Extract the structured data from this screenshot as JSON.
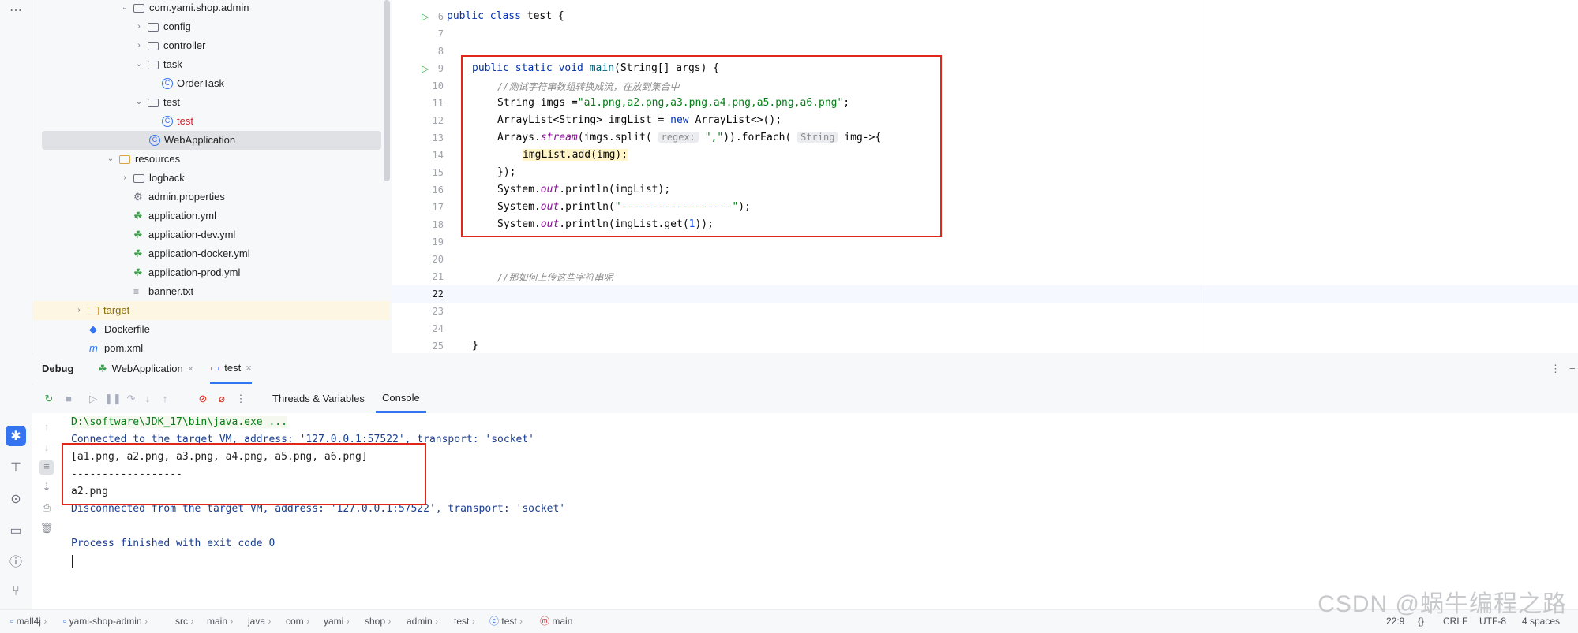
{
  "tree": {
    "items": [
      {
        "label": "com.yami.shop.admin",
        "type": "folder",
        "chev": "⌄"
      },
      {
        "label": "config",
        "type": "folder",
        "chev": "›"
      },
      {
        "label": "controller",
        "type": "folder",
        "chev": "›"
      },
      {
        "label": "task",
        "type": "folder",
        "chev": "⌄"
      },
      {
        "label": "OrderTask",
        "type": "class"
      },
      {
        "label": "test",
        "type": "folder",
        "chev": "⌄"
      },
      {
        "label": "test",
        "type": "class"
      },
      {
        "label": "WebApplication",
        "type": "class"
      },
      {
        "label": "resources",
        "type": "folder",
        "chev": "⌄"
      },
      {
        "label": "logback",
        "type": "folder",
        "chev": "›"
      },
      {
        "label": "admin.properties",
        "type": "props"
      },
      {
        "label": "application.yml",
        "type": "yml"
      },
      {
        "label": "application-dev.yml",
        "type": "yml"
      },
      {
        "label": "application-docker.yml",
        "type": "yml"
      },
      {
        "label": "application-prod.yml",
        "type": "yml"
      },
      {
        "label": "banner.txt",
        "type": "txt"
      },
      {
        "label": "target",
        "type": "folder",
        "chev": "›"
      },
      {
        "label": "Dockerfile",
        "type": "docker"
      },
      {
        "label": "pom.xml",
        "type": "maven"
      }
    ]
  },
  "editor": {
    "line_numbers": [
      "6",
      "7",
      "8",
      "9",
      "10",
      "11",
      "12",
      "13",
      "14",
      "15",
      "16",
      "17",
      "18",
      "19",
      "20",
      "21",
      "22",
      "23",
      "24",
      "25"
    ],
    "line1": {
      "kw": "public class ",
      "rest": "test {"
    },
    "line4": {
      "kw": "public static void ",
      "fn": "main",
      "rest": "(String[] args) {"
    },
    "line5": "//测试字符串数组转换成流，在放到集合中",
    "line6": {
      "a": "String imgs =",
      "s": "\"a1.png,a2.png,a3.png,a4.png,a5.png,a6.png\"",
      "b": ";"
    },
    "line7": {
      "a": "ArrayList<String> imgList = ",
      "kw": "new",
      "b": " ArrayList<>();"
    },
    "line8": {
      "a": "Arrays.",
      "st": "stream",
      "b": "(imgs.split( ",
      "hint": "regex:",
      "s": " \",\"",
      "c": ")).forEach( ",
      "hint2": "String",
      "d": " img->{"
    },
    "line9": "imgList.add(img);",
    "line10": "});",
    "line11": {
      "a": "System.",
      "st": "out",
      "b": ".println(imgList);"
    },
    "line12": {
      "a": "System.",
      "st": "out",
      "b": ".println(",
      "s": "\"------------------\"",
      "c": ");"
    },
    "line13": {
      "a": "System.",
      "st": "out",
      "b": ".println(imgList.get(",
      "n": "1",
      "c": "));"
    },
    "line16": "//那如何上传这些字符串呢",
    "line20": "}"
  },
  "debug": {
    "title": "Debug",
    "tabs": [
      "WebApplication",
      "test"
    ],
    "subtabs": [
      "Threads & Variables",
      "Console"
    ],
    "console_lines": [
      "D:\\software\\JDK_17\\bin\\java.exe ...",
      "Connected to the target VM, address: '127.0.0.1:57522', transport: 'socket'",
      "[a1.png, a2.png, a3.png, a4.png, a5.png, a6.png]",
      "------------------",
      "a2.png",
      "Disconnected from the target VM, address: '127.0.0.1:57522', transport: 'socket'",
      "",
      "Process finished with exit code 0"
    ]
  },
  "status": {
    "breadcrumbs": [
      "mall4j",
      "yami-shop-admin",
      "src",
      "main",
      "java",
      "com",
      "yami",
      "shop",
      "admin",
      "test",
      "test",
      "main"
    ],
    "position": "22:9",
    "line_sep": "CRLF",
    "encoding": "UTF-8",
    "indent": "4 spaces"
  },
  "watermark": "CSDN @蜗牛编程之路",
  "colors": {
    "keyword": "#0033b3",
    "string": "#067d17",
    "comment": "#8c8c8c",
    "highlight": "#e0271a",
    "accent": "#3574f0"
  }
}
